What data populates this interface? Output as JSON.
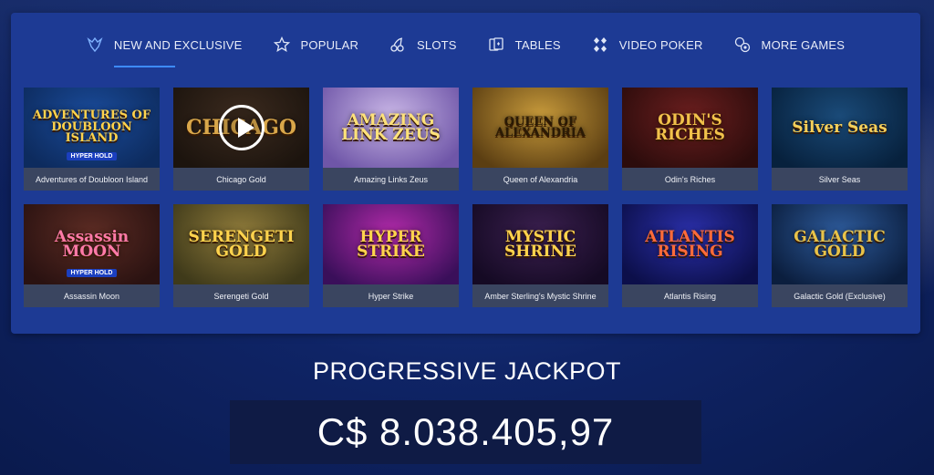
{
  "nav": {
    "items": [
      {
        "label": "NEW AND EXCLUSIVE",
        "icon": "wolf-icon",
        "active": true
      },
      {
        "label": "POPULAR",
        "icon": "star-icon"
      },
      {
        "label": "SLOTS",
        "icon": "cherry-icon"
      },
      {
        "label": "TABLES",
        "icon": "cards-icon"
      },
      {
        "label": "VIDEO POKER",
        "icon": "diamonds-icon"
      },
      {
        "label": "MORE GAMES",
        "icon": "chips-icon"
      }
    ]
  },
  "games": [
    {
      "name": "Adventures of Doubloon Island",
      "art": "ADVENTURES OF DOUBLOON ISLAND",
      "art_sub": "HYPER HOLD",
      "bg": [
        "#1a4b9a",
        "#0d2b5e"
      ],
      "color": "#ffd34d"
    },
    {
      "name": "Chicago Gold",
      "art": "CHICAGO",
      "bg": [
        "#3b2a1e",
        "#1c140e"
      ],
      "color": "#d9a74a",
      "play": true
    },
    {
      "name": "Amazing Links Zeus",
      "art": "AMAZING LINK ZEUS",
      "bg": [
        "#c9b6e6",
        "#6f56a8"
      ],
      "color": "#ffe27a"
    },
    {
      "name": "Queen of Alexandria",
      "art": "QUEEN OF ALEXANDRIA",
      "bg": [
        "#c79a3b",
        "#5b3e12"
      ],
      "color": "#2a1b06"
    },
    {
      "name": "Odin's Riches",
      "art": "ODIN'S RICHES",
      "bg": [
        "#6a1e1e",
        "#2c0c0c"
      ],
      "color": "#f2c24b"
    },
    {
      "name": "Silver Seas",
      "art": "Silver Seas",
      "bg": [
        "#1a4a78",
        "#07213d"
      ],
      "color": "#f4cf5a"
    },
    {
      "name": "Assassin Moon",
      "art": "Assassin MOON",
      "art_sub": "HYPER HOLD",
      "bg": [
        "#5b2b23",
        "#2a1211"
      ],
      "color": "#ff7aa8"
    },
    {
      "name": "Serengeti Gold",
      "art": "SERENGETI GOLD",
      "bg": [
        "#8e7a3a",
        "#3f3a1a"
      ],
      "color": "#ffd34d"
    },
    {
      "name": "Hyper Strike",
      "art": "HYPER STRIKE",
      "bg": [
        "#b02aa8",
        "#3a0f5a"
      ],
      "color": "#ffd34d"
    },
    {
      "name": "Amber Sterling's Mystic Shrine",
      "art": "MYSTIC SHRINE",
      "bg": [
        "#3a1f4e",
        "#150a24"
      ],
      "color": "#ffd34d"
    },
    {
      "name": "Atlantis Rising",
      "art": "ATLANTIS RISING",
      "bg": [
        "#2a2fa8",
        "#0c0f4a"
      ],
      "color": "#ff6b3a"
    },
    {
      "name": "Galactic Gold (Exclusive)",
      "art": "GALACTIC GOLD",
      "bg": [
        "#2d5a9a",
        "#0b1e3e"
      ],
      "color": "#e8c34a"
    }
  ],
  "jackpot": {
    "title": "PROGRESSIVE JACKPOT",
    "amount": "C$ 8.038.405,97"
  }
}
